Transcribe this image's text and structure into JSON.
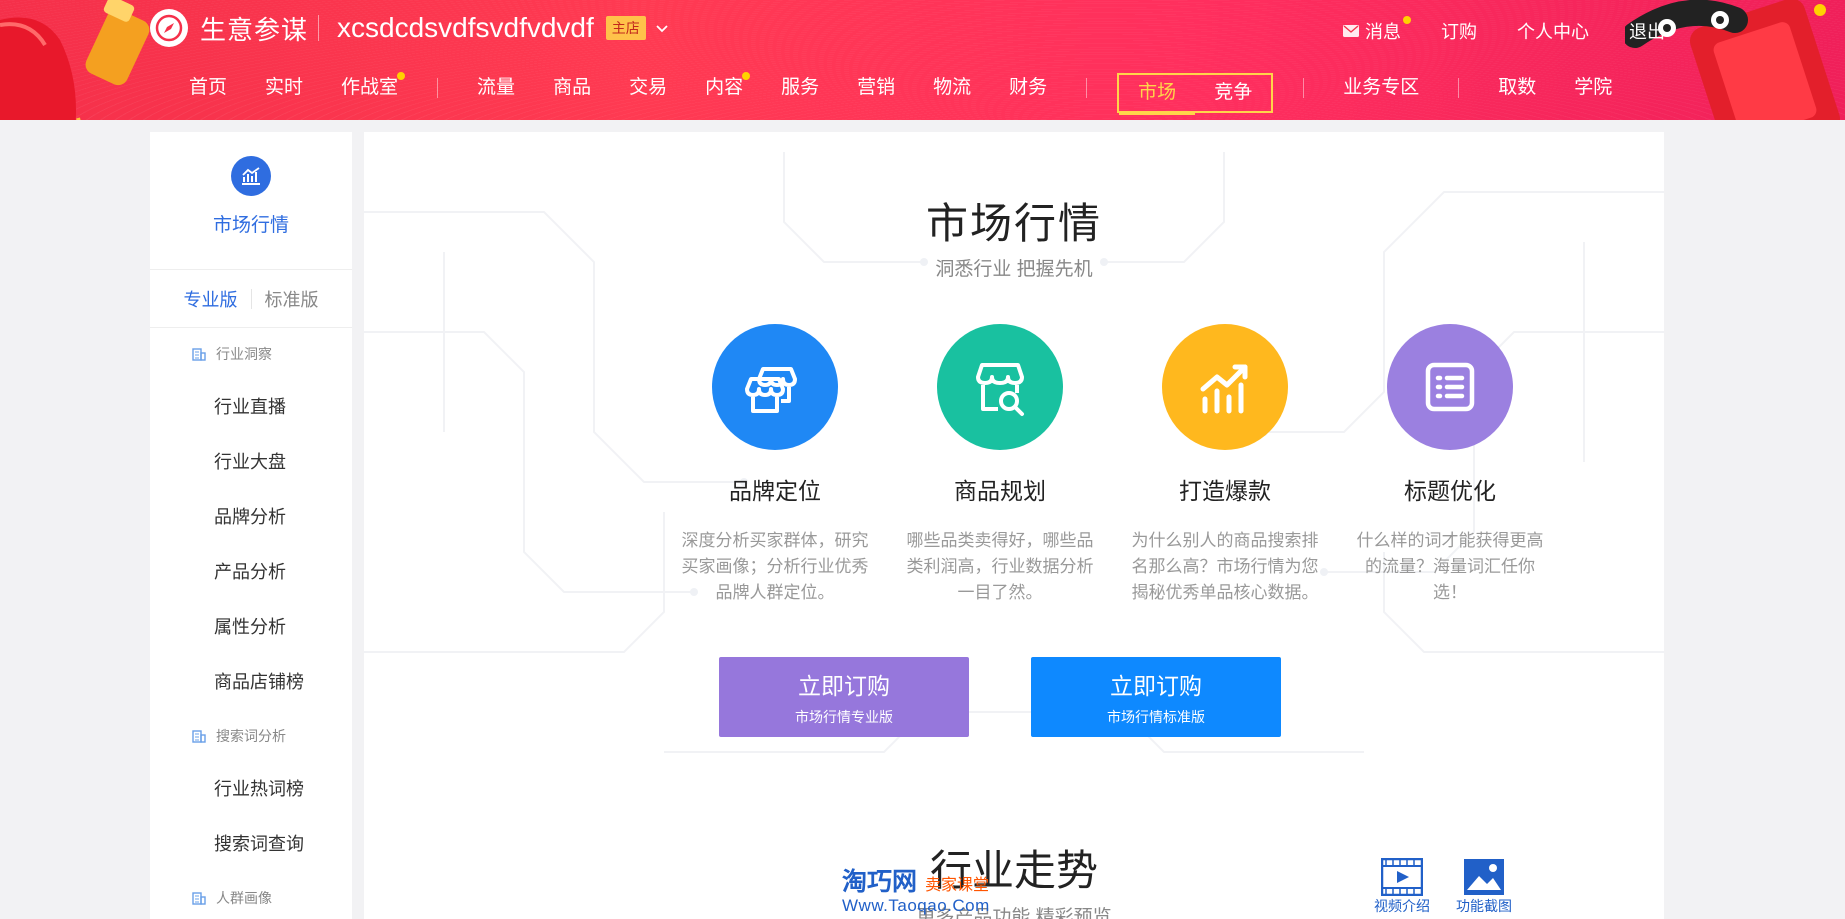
{
  "header": {
    "logo_text": "生意参谋",
    "shop_name": "xcsdcdsvdfsvdfvdvdf",
    "shop_badge": "主店",
    "top_links": [
      {
        "label": "消息",
        "has_dot": true
      },
      {
        "label": "订购"
      },
      {
        "label": "个人中心"
      },
      {
        "label": "退出"
      }
    ],
    "nav": [
      {
        "label": "首页"
      },
      {
        "label": "实时"
      },
      {
        "label": "作战室",
        "has_dot": true
      },
      {
        "label": "流量"
      },
      {
        "label": "商品"
      },
      {
        "label": "交易"
      },
      {
        "label": "内容",
        "has_dot": true
      },
      {
        "label": "服务"
      },
      {
        "label": "营销"
      },
      {
        "label": "物流"
      },
      {
        "label": "财务"
      },
      {
        "label": "市场",
        "active": true
      },
      {
        "label": "竞争"
      },
      {
        "label": "业务专区"
      },
      {
        "label": "取数"
      },
      {
        "label": "学院"
      }
    ],
    "accent_color": "#ffd54a"
  },
  "sidebar": {
    "title": "市场行情",
    "tabs": [
      "专业版",
      "标准版"
    ],
    "groups": [
      {
        "label": "行业洞察",
        "items": [
          "行业直播",
          "行业大盘",
          "品牌分析",
          "产品分析",
          "属性分析",
          "商品店铺榜"
        ]
      },
      {
        "label": "搜索词分析",
        "items": [
          "行业热词榜",
          "搜索词查询"
        ]
      },
      {
        "label": "人群画像",
        "items": []
      }
    ]
  },
  "main": {
    "title": "市场行情",
    "subtitle": "洞悉行业 把握先机",
    "features": [
      {
        "title": "品牌定位",
        "desc": "深度分析买家群体，研究买家画像；分析行业优秀品牌人群定位。",
        "color": "#1f88f5",
        "icon": "shop-icon"
      },
      {
        "title": "商品规划",
        "desc": "哪些品类卖得好，哪些品类利润高，行业数据分析一目了然。",
        "color": "#19c1a0",
        "icon": "shop-search-icon"
      },
      {
        "title": "打造爆款",
        "desc": "为什么别人的商品搜索排名那么高？市场行情为您揭秘优秀单品核心数据。",
        "color": "#ffb81e",
        "icon": "trend-chart-icon"
      },
      {
        "title": "标题优化",
        "desc": "什么样的词才能获得更高的流量？海量词汇任你选！",
        "color": "#9b80e0",
        "icon": "list-icon"
      }
    ],
    "buttons": [
      {
        "label": "立即订购",
        "sub": "市场行情专业版",
        "color": "#9677dc"
      },
      {
        "label": "立即订购",
        "sub": "市场行情标准版",
        "color": "#0e89ff"
      }
    ],
    "section2_title": "行业走势",
    "section2_sub": "更多产品功能    精彩预览",
    "watermark": {
      "name": "淘巧网",
      "tag": "卖家课堂",
      "url": "Www.Taoqao.Com"
    },
    "tools": [
      {
        "label": "视频介绍",
        "icon": "video-icon"
      },
      {
        "label": "功能截图",
        "icon": "image-icon"
      }
    ]
  }
}
